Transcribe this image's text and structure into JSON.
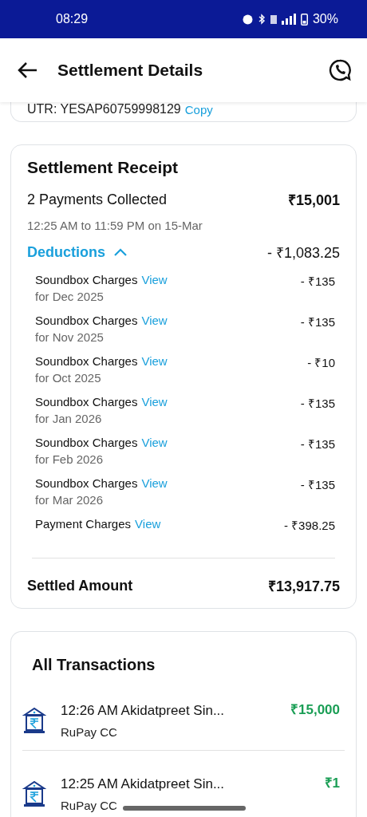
{
  "status_bar": {
    "time": "08:29",
    "battery": "30%"
  },
  "header": {
    "title": "Settlement Details"
  },
  "utr": {
    "text": "UTR: YESAP60759998129",
    "action": "Copy"
  },
  "receipt": {
    "title": "Settlement Receipt",
    "collected_label": "2 Payments Collected",
    "collected_amount": "₹15,001",
    "period": "12:25 AM to 11:59 PM on 15-Mar",
    "deductions": {
      "label": "Deductions",
      "expanded": true,
      "amount": "- ₹1,083.25",
      "items": [
        {
          "name": "Soundbox Charges",
          "link": "View",
          "detail": "for Dec 2025",
          "amount": "- ₹135"
        },
        {
          "name": "Soundbox Charges",
          "link": "View",
          "detail": "for Nov 2025",
          "amount": "- ₹135"
        },
        {
          "name": "Soundbox Charges",
          "link": "View",
          "detail": "for Oct 2025",
          "amount": "- ₹10"
        },
        {
          "name": "Soundbox Charges",
          "link": "View",
          "detail": "for Jan 2026",
          "amount": "- ₹135"
        },
        {
          "name": "Soundbox Charges",
          "link": "View",
          "detail": "for Feb 2026",
          "amount": "- ₹135"
        },
        {
          "name": "Soundbox Charges",
          "link": "View",
          "detail": "for Mar 2026",
          "amount": "- ₹135"
        },
        {
          "name": "Payment Charges",
          "link": "View",
          "amount": "- ₹398.25"
        }
      ]
    },
    "settled_label": "Settled Amount",
    "settled_amount": "₹13,917.75"
  },
  "transactions": {
    "title": "All Transactions",
    "items": [
      {
        "title": "12:26 AM Akidatpreet Sin...",
        "method": "RuPay CC",
        "amount": "₹15,000"
      },
      {
        "title": "12:25 AM Akidatpreet Sin...",
        "method": "RuPay CC",
        "amount": "₹1"
      }
    ]
  }
}
